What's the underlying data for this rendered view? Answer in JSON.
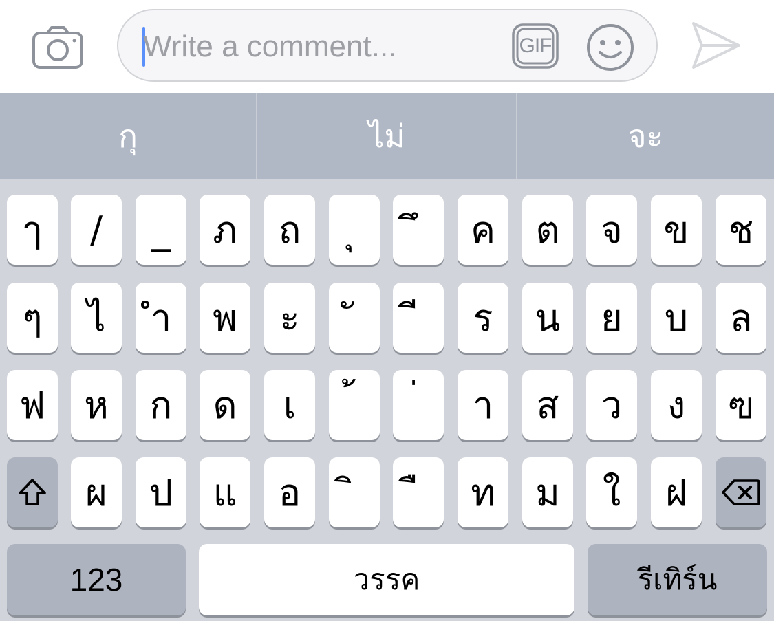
{
  "composer": {
    "placeholder": "Write a comment...",
    "camera_icon": "camera-icon",
    "gif_label": "GIF",
    "emoji_icon": "smiley-face-icon",
    "send_icon": "paper-plane-send-icon",
    "caret_color": "#5b8ff9"
  },
  "predictions": [
    "กุ",
    "ไม่",
    "จะ"
  ],
  "keyboard": {
    "row1": [
      "ๅ",
      "/",
      "_",
      "ภ",
      "ถ",
      "ุ",
      "ึ",
      "ค",
      "ต",
      "จ",
      "ข",
      "ช"
    ],
    "row2": [
      "ๆ",
      "ไ",
      "ำ",
      "พ",
      "ะ",
      "ั",
      "ี",
      "ร",
      "น",
      "ย",
      "บ",
      "ล"
    ],
    "row3": [
      "ฟ",
      "ห",
      "ก",
      "ด",
      "เ",
      "้",
      "่",
      "า",
      "ส",
      "ว",
      "ง",
      "ฃ"
    ],
    "row4": [
      "ผ",
      "ป",
      "แ",
      "อ",
      "ิ",
      "ื",
      "ท",
      "ม",
      "ใ",
      "ฝ"
    ],
    "shift_icon": "shift-arrow-icon",
    "delete_icon": "backspace-delete-icon",
    "numbers_label": "123",
    "space_label": "วรรค",
    "return_label": "รีเทิร์น",
    "colors": {
      "background": "#d1d4da",
      "prediction_bar": "#b1b8c5",
      "key": "#ffffff",
      "function_key": "#adb3bf"
    }
  }
}
